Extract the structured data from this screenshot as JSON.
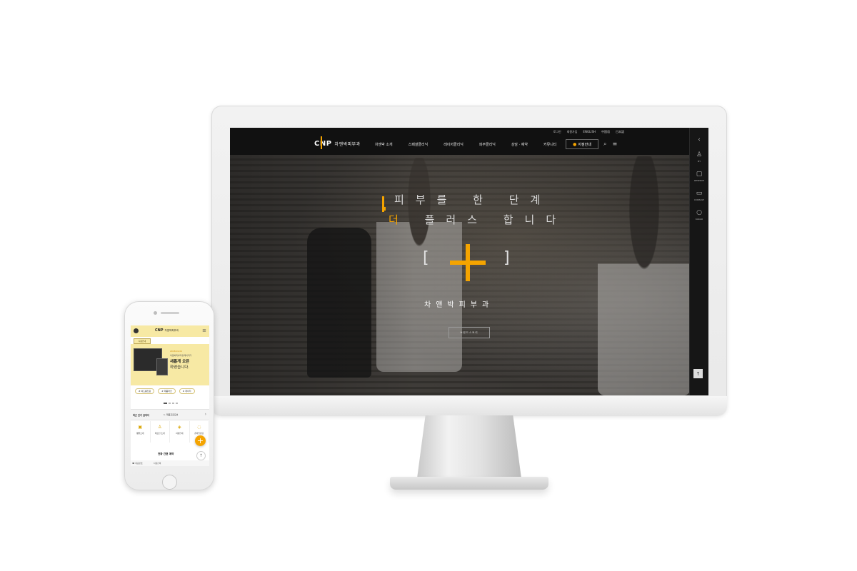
{
  "desktop": {
    "util_links": [
      "로그인",
      "회원가입",
      "ENGLISH",
      "中国语",
      "日本語"
    ],
    "logo": {
      "mark": "CNP",
      "text": "차앤박피부과"
    },
    "nav_items": [
      "차앤박 소개",
      "스페셜클리닉",
      "레이저클리닉",
      "피부클리닉",
      "상담 · 예약",
      "커뮤니티"
    ],
    "branch_button": "지점안내",
    "rail": {
      "items": [
        {
          "icon": "user-icon",
          "label": "MY"
        },
        {
          "icon": "calendar-icon",
          "label": "RESERVE"
        },
        {
          "icon": "chat-icon",
          "label": "CONSULT"
        },
        {
          "icon": "speech-icon",
          "label": "KAKAO"
        }
      ],
      "top_button": "↑"
    },
    "hero": {
      "tagline_line1": "피부를 한 단계",
      "tagline_line2_highlight": "더",
      "tagline_line2_rest": " 플러스 합니다",
      "bracket_left": "[",
      "bracket_right": "]",
      "title": "차앤박피부과",
      "button": "브랜드스토리"
    }
  },
  "mobile": {
    "logo_mark": "CNP",
    "logo_text": "차앤박피부과",
    "menu_icon": "menu-icon",
    "branch_button": "지점안내",
    "banner": {
      "date": "2018.01.01",
      "line1": "차앤박피부과홈페이지가",
      "line2": "새롭게 오픈",
      "line3": "하였습니다."
    },
    "tags": [
      "# 여드름진료",
      "# 제품라인",
      "# 레이저"
    ],
    "recent": {
      "label": "최근 인기 검색어",
      "value": "1. 제품프로모션"
    },
    "quick_menu": [
      {
        "icon": "hospital-icon",
        "label": "병원소개"
      },
      {
        "icon": "doctor-icon",
        "label": "의료진 소개"
      },
      {
        "icon": "map-icon",
        "label": "지점안내"
      },
      {
        "icon": "consult-icon",
        "label": "온라인상담"
      }
    ],
    "fab": "+",
    "top_button": "↑",
    "booking_title": "전화 간편 예약",
    "bottom_left": "☎ 대표번호",
    "bottom_right": "지점선택"
  },
  "colors": {
    "accent": "#f5a400",
    "mobile_header": "#f7e9a4",
    "screen_dark": "#111111"
  }
}
